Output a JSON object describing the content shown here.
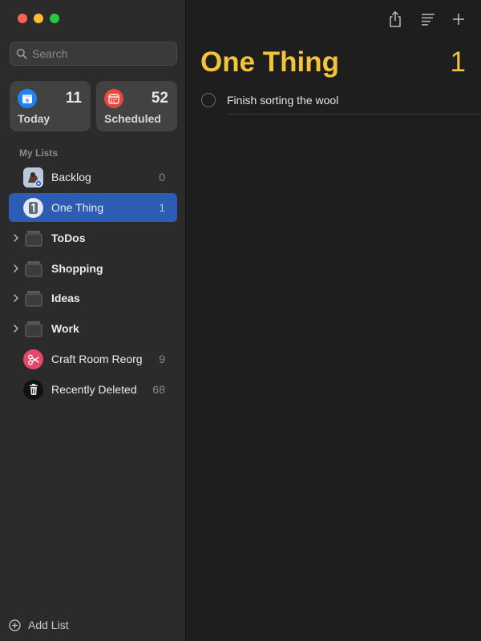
{
  "window": {
    "traffic_lights": [
      {
        "name": "close",
        "color": "#fe5f57"
      },
      {
        "name": "minimize",
        "color": "#febc2e"
      },
      {
        "name": "zoom",
        "color": "#28c840"
      }
    ]
  },
  "sidebar": {
    "search": {
      "placeholder": "Search",
      "value": ""
    },
    "smart_lists": [
      {
        "label": "Today",
        "count": "11",
        "icon": "calendar-icon",
        "icon_color": "#1e84f5",
        "icon_glyph": "9"
      },
      {
        "label": "Scheduled",
        "count": "52",
        "icon": "calendar-grid-icon",
        "icon_color": "#f0443a"
      }
    ],
    "section_label": "My Lists",
    "lists": [
      {
        "name": "Backlog",
        "count": "0",
        "icon": "photo-avatar-icon",
        "selected": false,
        "group": false
      },
      {
        "name": "One Thing",
        "count": "1",
        "icon": "number-one-icon",
        "selected": true,
        "group": false
      },
      {
        "name": "ToDos",
        "count": "",
        "icon": "folder-stack-icon",
        "selected": false,
        "group": true
      },
      {
        "name": "Shopping",
        "count": "",
        "icon": "folder-stack-icon",
        "selected": false,
        "group": true
      },
      {
        "name": "Ideas",
        "count": "",
        "icon": "folder-stack-icon",
        "selected": false,
        "group": true
      },
      {
        "name": "Work",
        "count": "",
        "icon": "folder-stack-icon",
        "selected": false,
        "group": true
      },
      {
        "name": "Craft Room Reorg",
        "count": "9",
        "icon": "scissors-icon",
        "icon_color": "#e8476a",
        "selected": false,
        "group": false
      },
      {
        "name": "Recently Deleted",
        "count": "68",
        "icon": "trash-icon",
        "selected": false,
        "group": false
      }
    ],
    "add_list_label": "Add List"
  },
  "toolbar": {
    "buttons": [
      {
        "name": "share-icon"
      },
      {
        "name": "list-options-icon"
      },
      {
        "name": "add-icon"
      }
    ]
  },
  "main": {
    "title": "One Thing",
    "count": "1",
    "accent_color": "#f2c43d",
    "tasks": [
      {
        "title": "Finish sorting the wool",
        "completed": false
      }
    ]
  }
}
